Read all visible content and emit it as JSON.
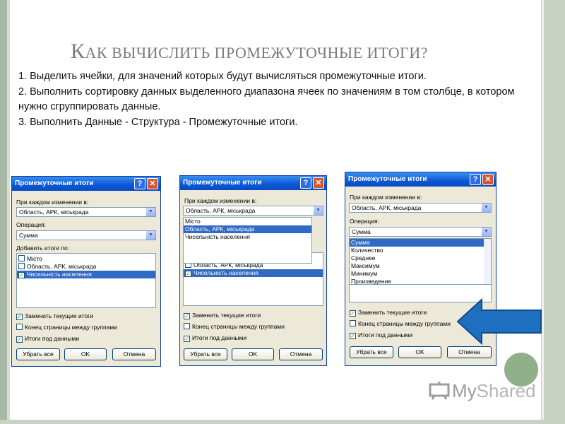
{
  "slide": {
    "title_first": "К",
    "title_rest": "АК ВЫЧИСЛИТЬ ПРОМЕЖУТОЧНЫЕ ИТОГИ?",
    "steps": [
      "1. Выделить ячейки, для значений которых будут вычисляться промежуточные итоги.",
      "2. Выполнить сортировку данных выделенного диапазона ячеек по значениям в том столбце, в котором нужно сгруппировать данные.",
      "3. Выполнить Данные - Структура - Промежуточные итоги."
    ]
  },
  "dialog": {
    "title": "Промежуточные итоги",
    "help_glyph": "?",
    "close_glyph": "✕",
    "group_by_label": "При каждом изменении в:",
    "group_by_value": "Область, АРК, міськрада",
    "operation_label": "Операция:",
    "operation_value": "Сумма",
    "add_totals_label": "Добавить итоги по:",
    "add_totals_items": [
      "Місто",
      "Область, АРК, міськрада",
      "Чисельність населення"
    ],
    "group_by_options": [
      "Місто",
      "Область, АРК, міськрада",
      "Чисельність населення"
    ],
    "operation_options": [
      "Сумма",
      "Количество",
      "Среднее",
      "Максимум",
      "Минимум",
      "Произведение"
    ],
    "replace_label": "Заменить текущие итоги",
    "pagebreak_label": "Конец страницы между группами",
    "summary_label": "Итоги под данными",
    "remove_all_label": "Убрать все",
    "ok_label": "OK",
    "cancel_label": "Отмена",
    "check_glyph": "✓",
    "combo_arrow_glyph": "▼"
  },
  "logo": {
    "part1": "My",
    "part2": "Shared"
  },
  "colors": {
    "titlebar": "#0a58d6",
    "dialog_bg": "#ece9d8",
    "selection": "#316ac5",
    "arrow": "#1f6fc0",
    "accent_green": "#8fb089"
  },
  "icons": [
    "help-icon",
    "close-icon",
    "dropdown-arrow-icon",
    "checkbox-icon",
    "right-arrow-icon",
    "myshared-logo-icon"
  ]
}
